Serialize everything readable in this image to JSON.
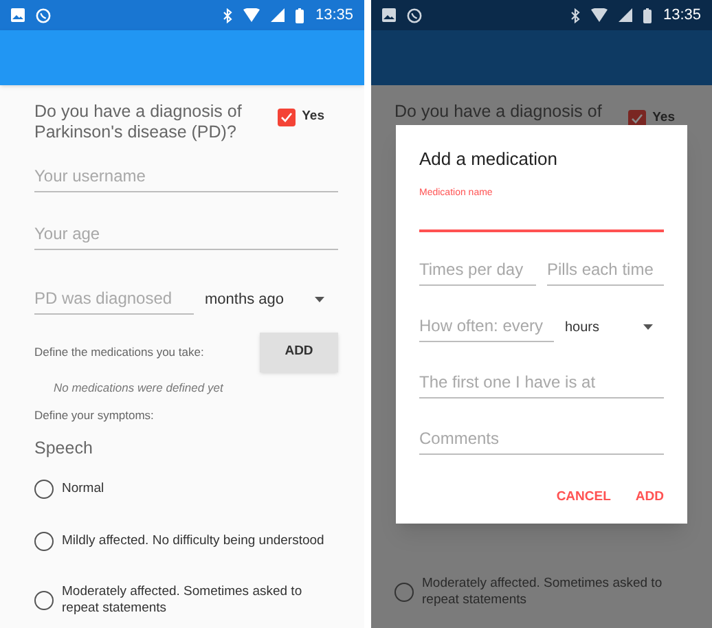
{
  "form_screen": {
    "status_time": "13:35",
    "question": "Do you have a diagnosis of Parkinson's disease (PD)?",
    "pd_checkbox": {
      "label": "Yes",
      "checked": true
    },
    "fields": [
      {
        "placeholder": "Your username"
      },
      {
        "placeholder": "Your age"
      }
    ],
    "diagnosed": {
      "placeholder": "PD was diagnosed",
      "unit": "months ago"
    },
    "medications": {
      "label": "Define the medications you take:",
      "button": "ADD",
      "empty_note": "No medications were defined yet"
    },
    "symptoms": {
      "label": "Define your symptoms:",
      "heading": "Speech",
      "options": [
        {
          "label": "Normal",
          "selected": false
        },
        {
          "label": "Mildly affected. No difficulty being understood",
          "selected": false
        },
        {
          "label": "Moderately affected. Sometimes asked to repeat statements",
          "selected": false
        }
      ]
    }
  },
  "dialog_screen": {
    "status_time": "13:35",
    "background": {
      "question_line": "Do you have a diagnosis of",
      "pd_checkbox": {
        "label": "Yes",
        "checked": true
      },
      "options": [
        {
          "label": "Moderately affected. Sometimes asked to repeat statements",
          "selected": false
        }
      ]
    },
    "dialog": {
      "title": "Add a medication",
      "fields": [
        {
          "kind": "focused",
          "label": "Medication name"
        },
        {
          "kind": "pair",
          "placeholders": [
            "Times per day",
            "Pills each time"
          ]
        },
        {
          "kind": "select",
          "placeholder": "How often: every",
          "value": "hours"
        },
        {
          "kind": "text",
          "placeholder": "The first one I have is at"
        },
        {
          "kind": "text",
          "placeholder": "Comments"
        }
      ],
      "actions": [
        "CANCEL",
        "ADD"
      ]
    }
  }
}
